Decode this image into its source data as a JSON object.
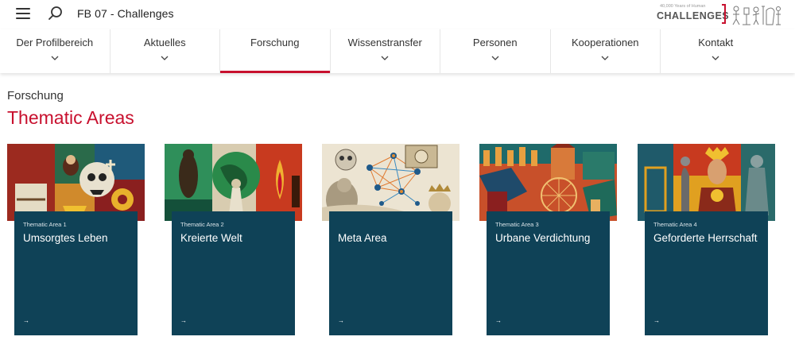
{
  "header": {
    "site_title": "FB 07 - Challenges",
    "logo": {
      "small_text": "40,000 Years of Human",
      "big_text": "CHALLENGES"
    }
  },
  "nav": {
    "items": [
      {
        "label": "Der Profilbereich",
        "active": false
      },
      {
        "label": "Aktuelles",
        "active": false
      },
      {
        "label": "Forschung",
        "active": true
      },
      {
        "label": "Wissenstransfer",
        "active": false
      },
      {
        "label": "Personen",
        "active": false
      },
      {
        "label": "Kooperationen",
        "active": false
      },
      {
        "label": "Kontakt",
        "active": false
      }
    ]
  },
  "main": {
    "breadcrumb": "Forschung",
    "title": "Thematic Areas",
    "cards": [
      {
        "eyebrow": "Thematic Area 1",
        "title": "Umsorgtes Leben",
        "arrow": "→"
      },
      {
        "eyebrow": "Thematic Area 2",
        "title": "Kreierte Welt",
        "arrow": "→"
      },
      {
        "eyebrow": "",
        "title": "Meta Area",
        "arrow": "→"
      },
      {
        "eyebrow": "Thematic Area 3",
        "title": "Urbane Verdichtung",
        "arrow": "→"
      },
      {
        "eyebrow": "Thematic Area 4",
        "title": "Geforderte Herr­schaft",
        "arrow": "→"
      }
    ]
  },
  "colors": {
    "accent": "#c8102e",
    "card_bg": "#0f4257",
    "text": "#333333"
  },
  "icons": [
    "hamburger-menu-icon",
    "search-icon",
    "chevron-down-icon",
    "arrow-right-icon"
  ]
}
